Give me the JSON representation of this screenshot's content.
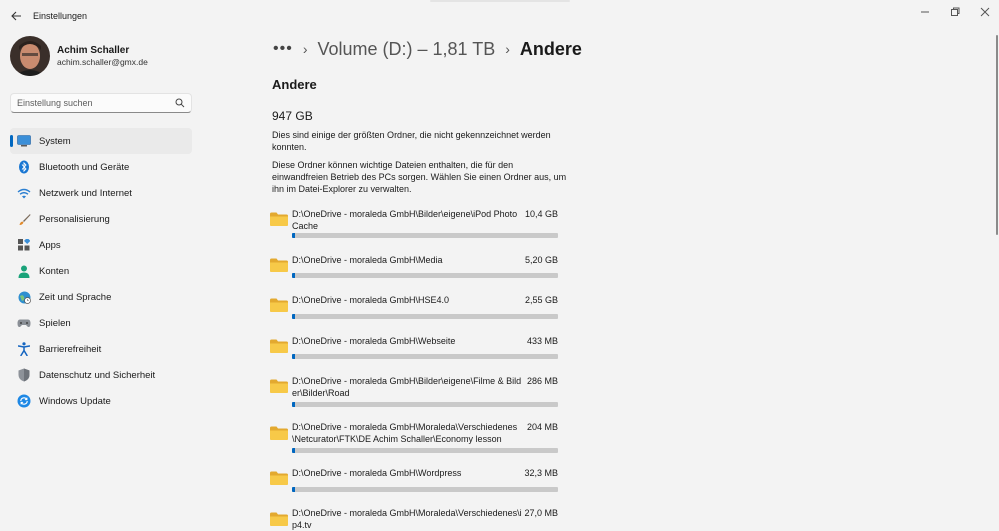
{
  "window": {
    "title": "Einstellungen",
    "controls": {
      "minimize": "—",
      "maximize": "▢",
      "close": "✕"
    }
  },
  "profile": {
    "name": "Achim Schaller",
    "email": "achim.schaller@gmx.de"
  },
  "search": {
    "placeholder": "Einstellung suchen"
  },
  "sidebar": {
    "items": [
      {
        "label": "System",
        "icon": "system-icon",
        "active": true
      },
      {
        "label": "Bluetooth und Geräte",
        "icon": "bluetooth-icon"
      },
      {
        "label": "Netzwerk und Internet",
        "icon": "network-icon"
      },
      {
        "label": "Personalisierung",
        "icon": "brush-icon"
      },
      {
        "label": "Apps",
        "icon": "apps-icon"
      },
      {
        "label": "Konten",
        "icon": "accounts-icon"
      },
      {
        "label": "Zeit und Sprache",
        "icon": "globe-clock-icon"
      },
      {
        "label": "Spielen",
        "icon": "gamepad-icon"
      },
      {
        "label": "Barrierefreiheit",
        "icon": "accessibility-icon"
      },
      {
        "label": "Datenschutz und Sicherheit",
        "icon": "shield-icon"
      },
      {
        "label": "Windows Update",
        "icon": "update-icon"
      }
    ]
  },
  "breadcrumb": {
    "more": "•••",
    "separator": "›",
    "parent": "Volume (D:) – 1,81 TB",
    "current": "Andere"
  },
  "main": {
    "section_title": "Andere",
    "total_size": "947 GB",
    "description_1": "Dies sind einige der größten Ordner, die nicht gekennzeichnet werden konnten.",
    "description_2": "Diese Ordner können wichtige Dateien enthalten, die für den einwandfreien Betrieb des PCs sorgen. Wählen Sie einen Ordner aus, um ihn im Datei-Explorer zu verwalten.",
    "folders": [
      {
        "path": "D:\\OneDrive - moraleda GmbH\\Bilder\\eigene\\iPod Photo Cache",
        "size": "10,4 GB",
        "fill": 0.011
      },
      {
        "path": "D:\\OneDrive - moraleda GmbH\\Media",
        "size": "5,20 GB",
        "fill": 0.008
      },
      {
        "path": "D:\\OneDrive - moraleda GmbH\\HSE4.0",
        "size": "2,55 GB",
        "fill": 0.006
      },
      {
        "path": "D:\\OneDrive - moraleda GmbH\\Webseite",
        "size": "433 MB",
        "fill": 0.004
      },
      {
        "path": "D:\\OneDrive - moraleda GmbH\\Bilder\\eigene\\Filme & Bilder\\Bilder\\Road",
        "size": "286 MB",
        "fill": 0.004
      },
      {
        "path": "D:\\OneDrive - moraleda GmbH\\Moraleda\\Verschiedenes\\Netcurator\\FTK\\DE Achim Schaller\\Economy lesson",
        "size": "204 MB",
        "fill": 0.004
      },
      {
        "path": "D:\\OneDrive - moraleda GmbH\\Wordpress",
        "size": "32,3 MB",
        "fill": 0.004
      },
      {
        "path": "D:\\OneDrive - moraleda GmbH\\Moraleda\\Verschiedenes\\ip4.tv",
        "size": "27,0 MB",
        "fill": 0.004
      }
    ]
  },
  "colors": {
    "accent": "#0067c0",
    "folder": "#f7c948",
    "folder_dark": "#e3a92f"
  }
}
